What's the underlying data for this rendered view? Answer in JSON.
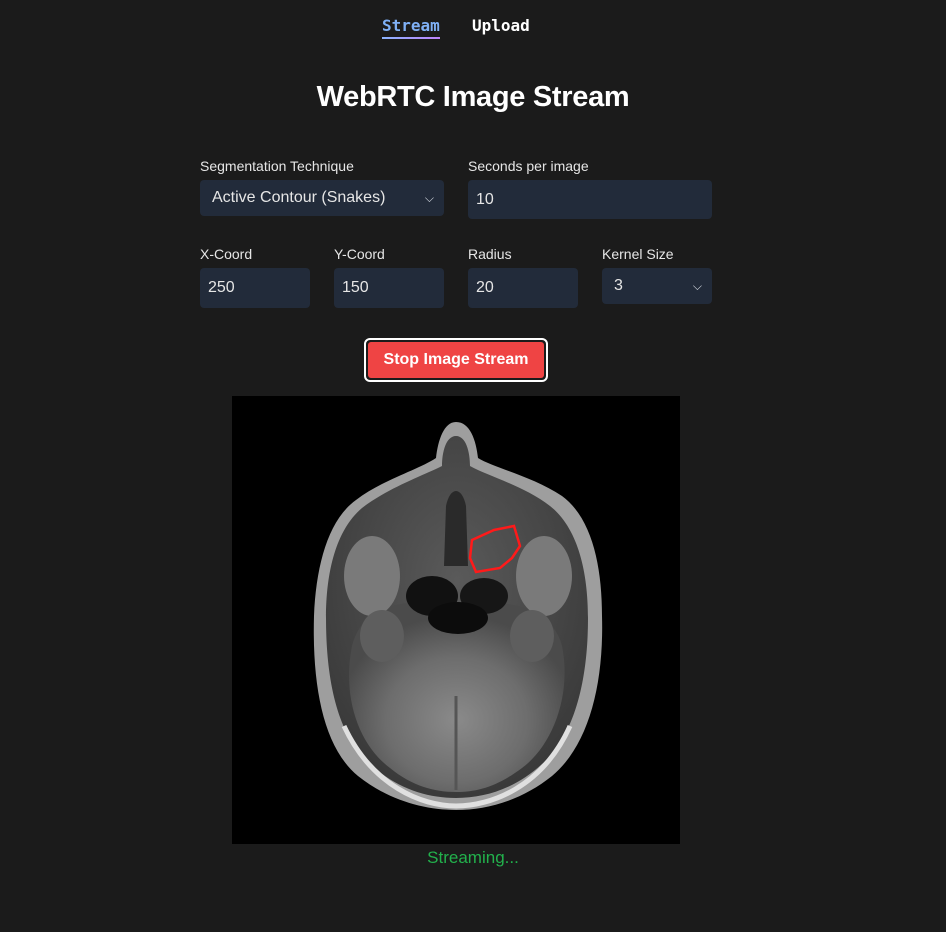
{
  "nav": {
    "stream_label": "Stream",
    "upload_label": "Upload"
  },
  "page_title": "WebRTC Image Stream",
  "form": {
    "technique": {
      "label": "Segmentation Technique",
      "value": "Active Contour (Snakes)"
    },
    "seconds_per_image": {
      "label": "Seconds per image",
      "value": "10"
    },
    "x_coord": {
      "label": "X-Coord",
      "value": "250"
    },
    "y_coord": {
      "label": "Y-Coord",
      "value": "150"
    },
    "radius": {
      "label": "Radius",
      "value": "20"
    },
    "kernel_size": {
      "label": "Kernel Size",
      "value": "3"
    }
  },
  "stop_button_label": "Stop Image Stream",
  "image": {
    "description_icon": "mri-axial-brain-scan",
    "contour_color": "#ff1a1a"
  },
  "status_text": "Streaming...",
  "colors": {
    "accent_red": "#ef4444",
    "status_green": "#22b14c",
    "input_bg": "#222b3a"
  }
}
